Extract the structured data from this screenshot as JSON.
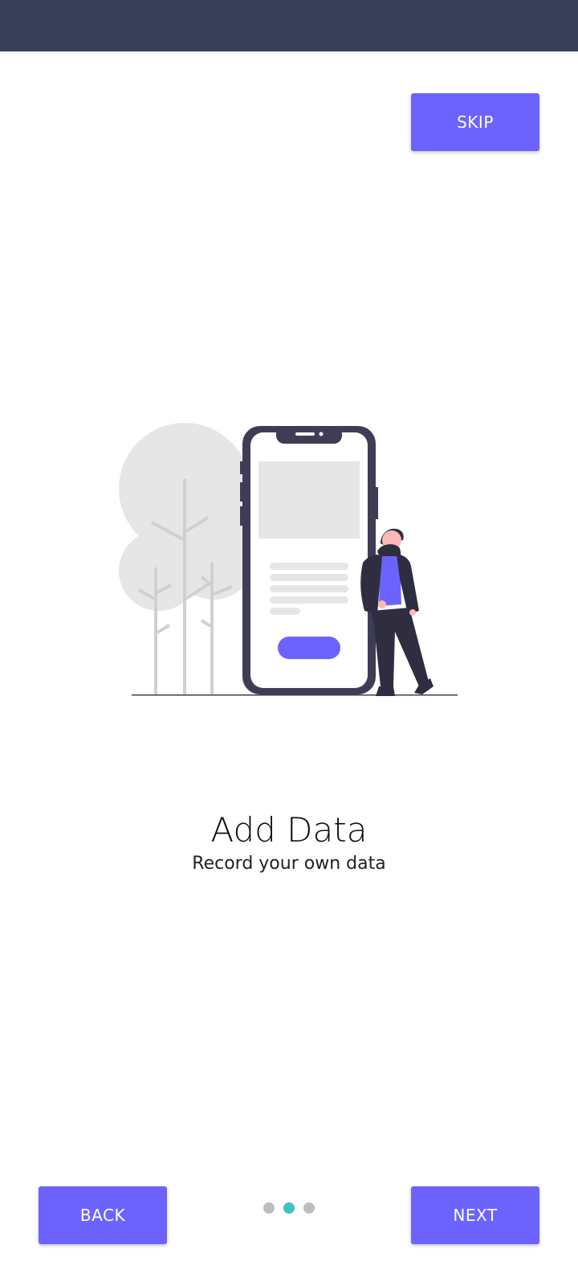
{
  "buttons": {
    "skip_label": "SKIP",
    "back_label": "BACK",
    "next_label": "NEXT"
  },
  "onboarding": {
    "title": "Add Data",
    "subtitle": "Record your own data",
    "page_index": 2,
    "page_count": 3
  },
  "colors": {
    "status_bar": "#373f59",
    "accent": "#6c63ff",
    "active_dot": "#3fc1c9",
    "inactive_dot": "#bdbdbd"
  },
  "icons": {
    "illustration": "person-with-phone-illustration"
  }
}
